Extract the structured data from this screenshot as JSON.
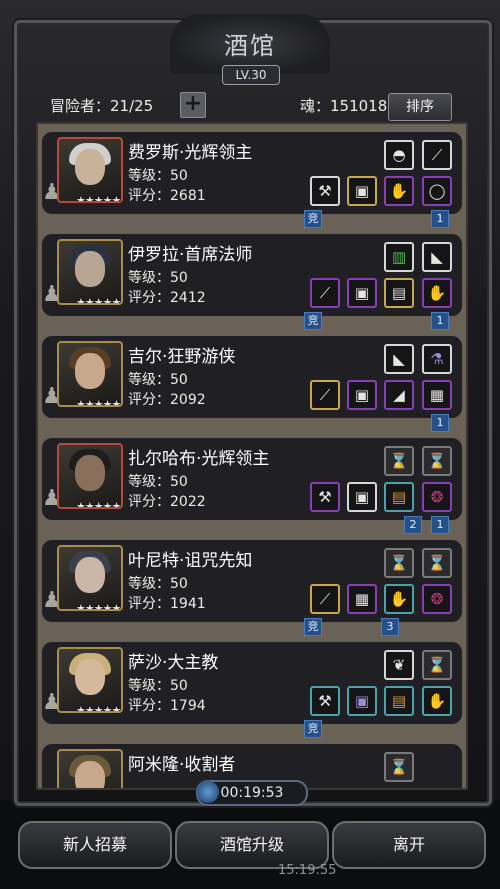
{
  "header": {
    "title": "酒馆",
    "level": "LV.30",
    "adventurers": "冒险者：21/25",
    "soul": "魂：151018",
    "sort_label": "排序"
  },
  "heroes": [
    {
      "name": "费罗斯·光辉领主",
      "level": "等级：50",
      "score": "评分：2681",
      "tags": [
        "竞",
        "1"
      ]
    },
    {
      "name": "伊罗拉·首席法师",
      "level": "等级：50",
      "score": "评分：2412",
      "tags": [
        "竞",
        "1"
      ]
    },
    {
      "name": "吉尔·狂野游侠",
      "level": "等级：50",
      "score": "评分：2092",
      "tags": [
        "1"
      ]
    },
    {
      "name": "扎尔哈布·光辉领主",
      "level": "等级：50",
      "score": "评分：2022",
      "tags": [
        "2",
        "1"
      ]
    },
    {
      "name": "叶尼特·诅咒先知",
      "level": "等级：50",
      "score": "评分：1941",
      "tags": [
        "竞",
        "3"
      ]
    },
    {
      "name": "萨沙·大主教",
      "level": "等级：50",
      "score": "评分：1794",
      "tags": [
        "竞"
      ]
    },
    {
      "name": "阿米隆·收割者"
    }
  ],
  "footer": {
    "timer": "00:19:53",
    "recruit": "新人招募",
    "upgrade": "酒馆升级",
    "leave": "离开",
    "bottom_time": "15:19:55"
  }
}
